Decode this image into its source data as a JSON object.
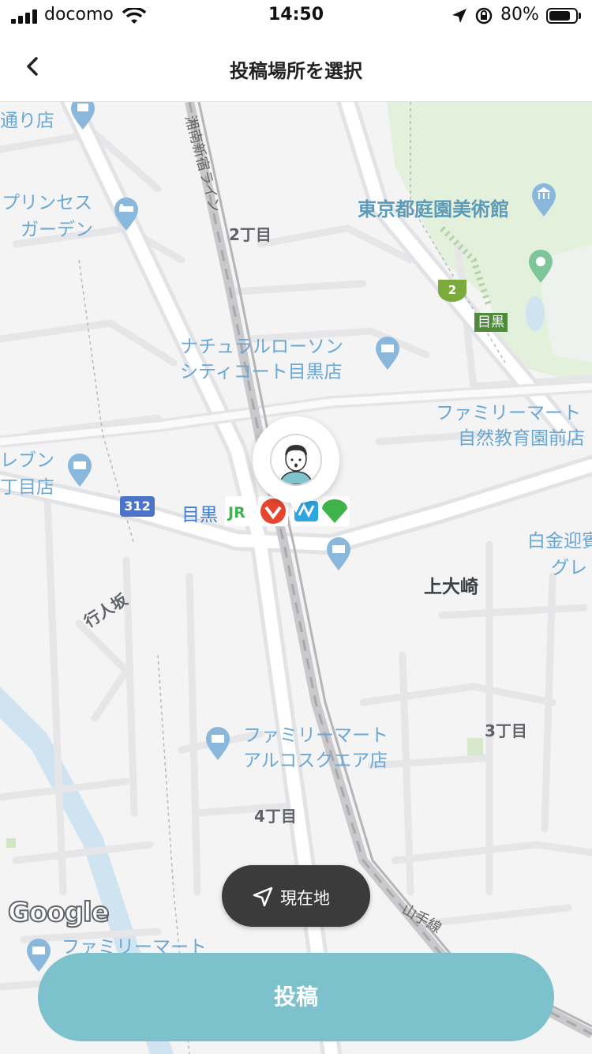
{
  "status_bar": {
    "carrier": "docomo",
    "time": "14:50",
    "battery_percent": "80%",
    "battery_level": 0.8,
    "icons": [
      "signal-icon",
      "wifi-icon",
      "location-arrow-icon",
      "rotation-lock-icon",
      "battery-icon"
    ]
  },
  "nav": {
    "back_icon": "chevron-left-icon",
    "title": "投稿場所を選択"
  },
  "map": {
    "poi_labels": {
      "dori_ten": "通り店",
      "prince_1": "プリンセス",
      "prince_2": "ガーデン",
      "natural_lawson_1": "ナチュラルローソン",
      "natural_lawson_2": "シティコート目黒店",
      "familymart_shizen_1": "ファミリーマート",
      "familymart_shizen_2": "自然教育園前店",
      "eleven_1": "レブン",
      "eleven_2": "丁目店",
      "shirokane_1": "白金迎賓",
      "shirokane_2": "グレ",
      "familymart_arco_1": "ファミリーマート",
      "familymart_arco_2": "アルコスクエア店",
      "familymart_bottom": "ファミリーマート"
    },
    "park_label": "東京都庭園美術館",
    "area_labels": {
      "nichome": "2丁目",
      "kamiosaki": "上大崎",
      "sanchome": "3丁目",
      "yonchome": "4丁目",
      "gyoninzaka": "行人坂"
    },
    "rail_labels": {
      "shonan_shinjuku": "湘南新宿ライン",
      "yamanote": "山手線"
    },
    "station_label": "目黒",
    "station_box": "目黒",
    "route_shield_312": "312",
    "route_shield_2": "2",
    "google_logo": "Google"
  },
  "current_location_button": {
    "icon": "navigation-arrow-icon",
    "label": "現在地"
  },
  "post_button": {
    "label": "投稿"
  },
  "colors": {
    "post_button": "#7dc1cc",
    "current_location_bg": "#3b3b3b",
    "poi_text": "#69a7d4",
    "park_green": "#e3f0dc"
  }
}
